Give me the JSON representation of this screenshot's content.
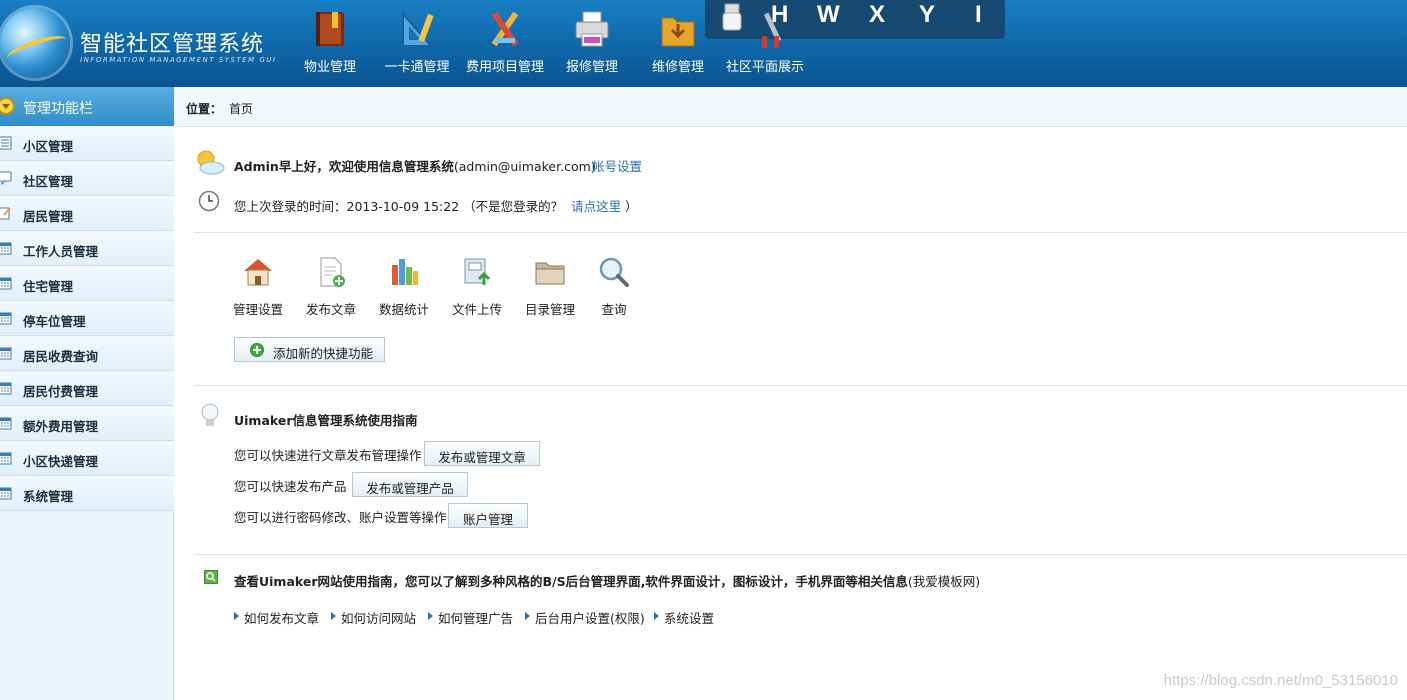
{
  "header": {
    "logo_title": "智能社区管理系统",
    "logo_subtitle": "INFORMATION MANAGEMENT SYSTEM GUI",
    "nav": [
      {
        "label": "物业管理",
        "icon": "book-icon"
      },
      {
        "label": "一卡通管理",
        "icon": "ruler-triangle-icon"
      },
      {
        "label": "费用项目管理",
        "icon": "pencil-ruler-icon"
      },
      {
        "label": "报修管理",
        "icon": "printer-icon"
      },
      {
        "label": "维修管理",
        "icon": "folder-download-icon"
      },
      {
        "label": "社区平面展示",
        "icon": "tools-icon"
      }
    ],
    "hotkeys": [
      "H",
      "W",
      "X",
      "Y",
      "I"
    ]
  },
  "sidebar": {
    "title": "管理功能栏",
    "items": [
      {
        "label": "小区管理",
        "icon": "list-icon"
      },
      {
        "label": "社区管理",
        "icon": "chat-icon"
      },
      {
        "label": "居民管理",
        "icon": "edit-icon"
      },
      {
        "label": "工作人员管理",
        "icon": "calendar-icon"
      },
      {
        "label": "住宅管理",
        "icon": "calendar-icon"
      },
      {
        "label": "停车位管理",
        "icon": "calendar-icon"
      },
      {
        "label": "居民收费查询",
        "icon": "calendar-icon"
      },
      {
        "label": "居民付费管理",
        "icon": "calendar-icon"
      },
      {
        "label": "额外费用管理",
        "icon": "calendar-icon"
      },
      {
        "label": "小区快递管理",
        "icon": "calendar-icon"
      },
      {
        "label": "系统管理",
        "icon": "calendar-icon"
      }
    ]
  },
  "breadcrumb": {
    "label": "位置：",
    "current": "首页"
  },
  "welcome": {
    "user": "Admin早上好，欢迎使用信息管理系统",
    "email": "(admin@uimaker.com)",
    "account_link": "帐号设置",
    "last_login_prefix": "您上次登录的时间：2013-10-09 15:22 （不是您登录的？",
    "last_login_link": "请点这里",
    "last_login_suffix": "）"
  },
  "shortcuts": [
    {
      "label": "管理设置",
      "icon": "house-icon"
    },
    {
      "label": "发布文章",
      "icon": "document-add-icon"
    },
    {
      "label": "数据统计",
      "icon": "bar-stats-icon"
    },
    {
      "label": "文件上传",
      "icon": "file-upload-icon"
    },
    {
      "label": "目录管理",
      "icon": "folder-icon"
    },
    {
      "label": "查询",
      "icon": "magnifier-icon"
    }
  ],
  "add_shortcut": "添加新的快捷功能",
  "guide": {
    "title": "Uimaker信息管理系统使用指南",
    "rows": [
      {
        "text": "您可以快速进行文章发布管理操作",
        "button": "发布或管理文章"
      },
      {
        "text": "您可以快速发布产品",
        "button": "发布或管理产品"
      },
      {
        "text": "您可以进行密码修改、账户设置等操作",
        "button": "账户管理"
      }
    ]
  },
  "site_guide": {
    "title": "查看Uimaker网站使用指南，您可以了解到多种风格的B/S后台管理界面,软件界面设计，图标设计，手机界面等相关信息",
    "title_suffix": "(我爱模板网)",
    "links": [
      "如何发布文章",
      "如何访问网站",
      "如何管理广告",
      "后台用户设置(权限)",
      "系统设置"
    ]
  },
  "watermark": "https://blog.csdn.net/m0_53156010"
}
